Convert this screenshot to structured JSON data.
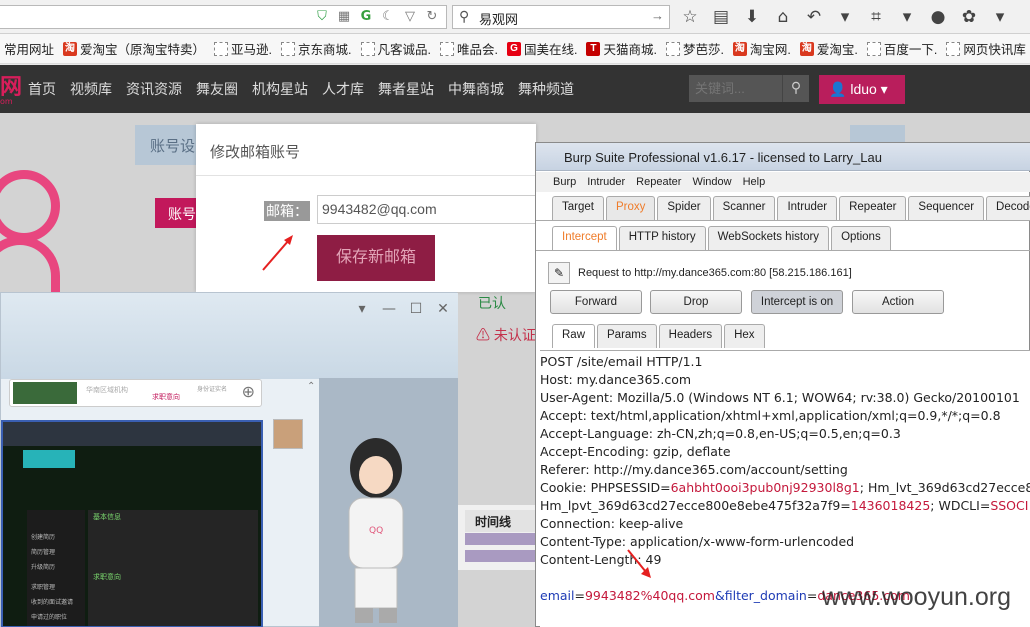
{
  "browser": {
    "search_text": "易观网",
    "bookmarks": [
      {
        "label": "常用网址",
        "icon": "none"
      },
      {
        "label": "爱淘宝（原淘宝特卖）",
        "icon": "taobao"
      },
      {
        "label": "亚马逊.",
        "icon": "page"
      },
      {
        "label": "京东商城.",
        "icon": "page"
      },
      {
        "label": "凡客诚品.",
        "icon": "page"
      },
      {
        "label": "唯品会.",
        "icon": "page"
      },
      {
        "label": "国美在线.",
        "icon": "guomei"
      },
      {
        "label": "天猫商城.",
        "icon": "tmall"
      },
      {
        "label": "梦芭莎.",
        "icon": "page"
      },
      {
        "label": "淘宝网.",
        "icon": "taobao"
      },
      {
        "label": "爱淘宝.",
        "icon": "taobao"
      },
      {
        "label": "百度一下.",
        "icon": "page"
      },
      {
        "label": "网页快讯库",
        "icon": "page"
      }
    ]
  },
  "site": {
    "logo": "网",
    "logo_sub": "om",
    "nav": [
      "首页",
      "视频库",
      "资讯资源",
      "舞友圈",
      "机构星站",
      "人才库",
      "舞者星站",
      "中舞商城",
      "舞种频道"
    ],
    "search_placeholder": "关键词...",
    "user": "lduo ▾",
    "account_tab": "账号设",
    "account_btn": "账号",
    "behind_red": "未认证",
    "behind_green": "已认",
    "table_header": "时间线"
  },
  "email_dialog": {
    "title": "修改邮箱账号",
    "label": "邮箱：",
    "value": "9943482@qq.com",
    "save": "保存新邮箱"
  },
  "chat": {
    "snippet_tag": "求职意向",
    "snippet_line": "华南区域机构",
    "snippet_line2": "身份证实名",
    "thumb_section1": "基本信息",
    "thumb_section2": "求职意向",
    "thumb_side": [
      "创建简历",
      "简历管理",
      "升级简历",
      "求职管理",
      "收到的面试邀请",
      "申请过的职位"
    ]
  },
  "burp": {
    "title": "Burp Suite Professional v1.6.17 - licensed to Larry_Lau",
    "menu": [
      "Burp",
      "Intruder",
      "Repeater",
      "Window",
      "Help"
    ],
    "tabs": [
      "Target",
      "Proxy",
      "Spider",
      "Scanner",
      "Intruder",
      "Repeater",
      "Sequencer",
      "Decoder",
      "C"
    ],
    "subtabs": [
      "Intercept",
      "HTTP history",
      "WebSockets history",
      "Options"
    ],
    "request_to": "Request to http://my.dance365.com:80  [58.215.186.161]",
    "buttons": {
      "forward": "Forward",
      "drop": "Drop",
      "intercept": "Intercept is on",
      "action": "Action"
    },
    "view_tabs": [
      "Raw",
      "Params",
      "Headers",
      "Hex"
    ],
    "raw": {
      "l1": "POST /site/email HTTP/1.1",
      "l2": "Host: my.dance365.com",
      "l3": "User-Agent: Mozilla/5.0 (Windows NT 6.1; WOW64; rv:38.0) Gecko/20100101",
      "l4": "Accept: text/html,application/xhtml+xml,application/xml;q=0.9,*/*;q=0.8",
      "l5": "Accept-Language: zh-CN,zh;q=0.8,en-US;q=0.5,en;q=0.3",
      "l6": "Accept-Encoding: gzip, deflate",
      "l7": "Referer: http://my.dance365.com/account/setting",
      "cookie_k1": "Cookie: PHPSESSID=",
      "cookie_v1": "6ahbht0ooi3pub0nj92930l8g1",
      "cookie_k2": "; Hm_lvt_369d63cd27ecce8",
      "cookie_k3": "Hm_lpvt_369d63cd27ecce800e8ebe475f32a7f9=",
      "cookie_v3": "1436018425",
      "cookie_k4": "; WDCLI=",
      "cookie_v4": "SSOCI",
      "l9": "Connection: keep-alive",
      "l10": "Content-Type: application/x-www-form-urlencoded",
      "l11": "Content-Length: 49",
      "body_k1": "email",
      "body_v1": "9943482%40qq.com",
      "body_k2": "&filter_domain",
      "body_v2": "dance365.com"
    }
  },
  "watermark": "www.wooyun.org"
}
